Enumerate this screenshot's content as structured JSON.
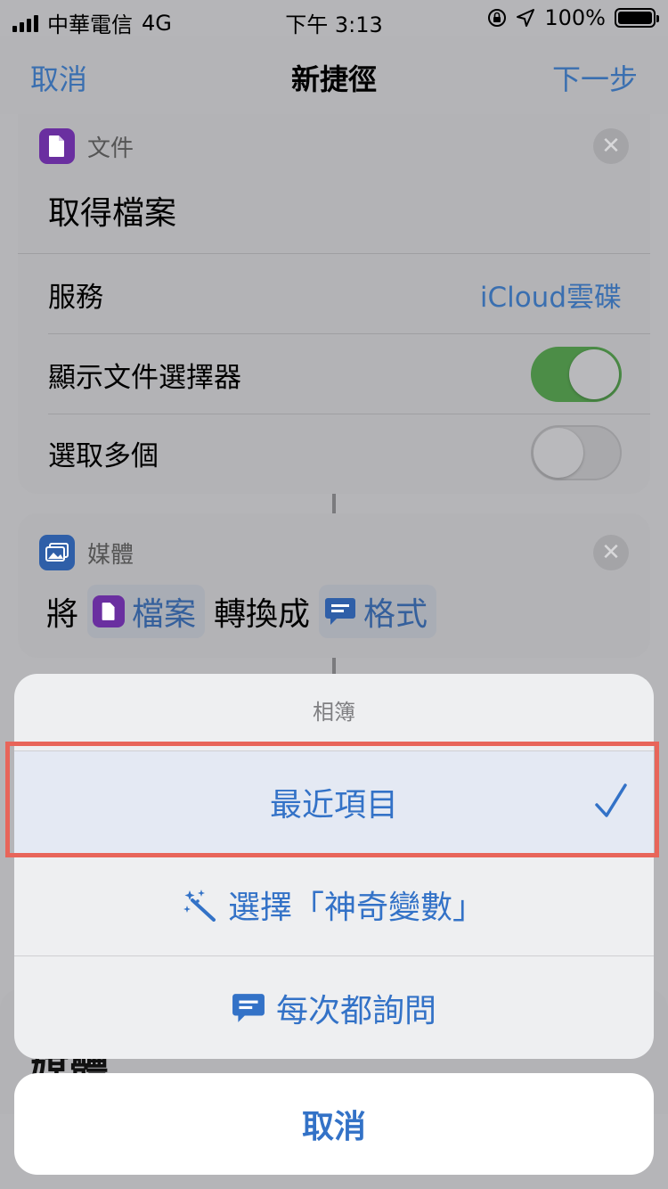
{
  "status_bar": {
    "carrier": "中華電信",
    "network": "4G",
    "time": "下午 3:13",
    "battery": "100%",
    "icons": [
      "signal-icon",
      "orientation-lock-icon",
      "location-icon",
      "battery-icon"
    ]
  },
  "nav": {
    "cancel": "取消",
    "title": "新捷徑",
    "next": "下一步"
  },
  "card_files": {
    "category": "文件",
    "title": "取得檔案",
    "rows": [
      {
        "label": "服務",
        "value": "iCloud雲碟"
      },
      {
        "label": "顯示文件選擇器",
        "toggle": true
      },
      {
        "label": "選取多個",
        "toggle": false
      }
    ]
  },
  "card_media": {
    "category": "媒體",
    "verb": "將",
    "token1": "檔案",
    "middle": "轉換成",
    "token2": "格式"
  },
  "card_behind": {
    "peek_text": "媒體"
  },
  "sheet": {
    "header": "相簿",
    "options": [
      {
        "label": "最近項目",
        "selected": true,
        "icon": "checkmark-icon"
      },
      {
        "label": "選擇「神奇變數」",
        "icon": "magic-wand-icon"
      },
      {
        "label": "每次都詢問",
        "icon": "speech-bubble-icon"
      }
    ],
    "cancel": "取消"
  },
  "colors": {
    "accent": "#3372c7",
    "toggle_on": "#4c8d47",
    "files_icon": "#6a2fa0",
    "media_icon": "#2f5fa8",
    "highlight": "#e8655a"
  }
}
